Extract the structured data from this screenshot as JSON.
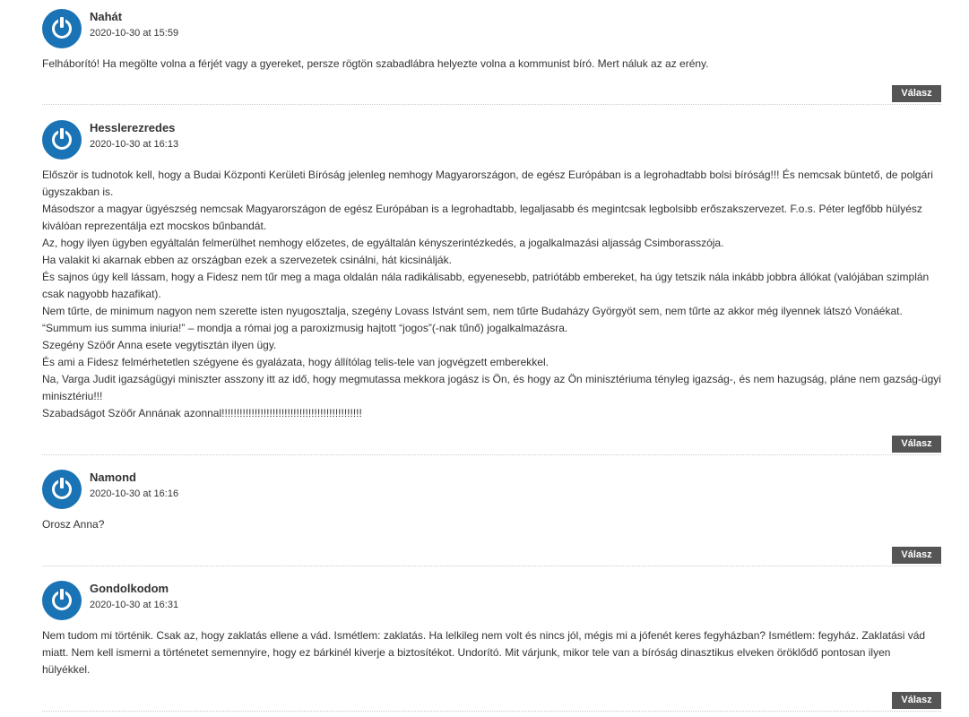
{
  "reply_label": "Válasz",
  "colors": {
    "avatar": "#1a73b5",
    "reply_button": "#555555",
    "text": "#333333"
  },
  "comments": [
    {
      "author": "Nahát",
      "date": "2020-10-30 at 15:59",
      "paragraphs": [
        "Felháborító! Ha megölte volna a férjét vagy a gyereket, persze rögtön szabadlábra helyezte volna a kommunist bíró. Mert náluk az az erény."
      ]
    },
    {
      "author": "Hesslerezredes",
      "date": "2020-10-30 at 16:13",
      "paragraphs": [
        "Először is tudnotok kell, hogy a Budai Központi Kerületi Bíróság jelenleg nemhogy Magyarországon, de egész Európában is a legrohadtabb bolsi bíróság!!! És nemcsak büntető, de polgári ügyszakban is.",
        "Másodszor a magyar ügyészség nemcsak Magyarországon de egész Európában is a legrohadtabb, legaljasabb és megintcsak legbolsibb erőszakszervezet. F.o.s. Péter legfőbb hülyész kiválóan reprezentálja ezt mocskos bűnbandát.",
        "Az, hogy ilyen ügyben egyáltalán felmerülhet nemhogy előzetes, de egyáltalán kényszerintézkedés, a jogalkalmazási aljasság Csimborasszója.",
        "Ha valakit ki akarnak ebben az országban ezek a szervezetek csinálni, hát kicsinálják.",
        "És sajnos úgy kell lássam, hogy a Fidesz nem tűr meg a maga oldalán nála radikálisabb, egyenesebb, patriótább embereket, ha úgy tetszik nála inkább jobbra állókat (valójában szimplán csak nagyobb hazafikat).",
        "Nem tűrte, de minimum nagyon nem szerette isten nyugosztalja, szegény Lovass Istvánt sem, nem tűrte Budaházy Györgyöt sem, nem tűrte az akkor még ilyennek látszó Vonáékat.",
        "“Summum ius summa iniuria!” – mondja a római jog a paroxizmusig hajtott “jogos”(-nak tűnő) jogalkalmazásra.",
        "Szegény Szöőr Anna esete vegytisztán ilyen ügy.",
        "És ami a Fidesz felmérhetetlen szégyene és gyalázata, hogy állítólag telis-tele van jogvégzett emberekkel.",
        "Na, Varga Judit igazságügyi miniszter asszony itt az idő, hogy megmutassa mekkora jogász is Ön, és hogy az Ön minisztériuma tényleg igazság-, és nem hazugság, pláne nem gazság-ügyi minisztériu!!!",
        "Szabadságot Szöőr Annának azonnal!!!!!!!!!!!!!!!!!!!!!!!!!!!!!!!!!!!!!!!!!!!!!!!"
      ]
    },
    {
      "author": "Namond",
      "date": "2020-10-30 at 16:16",
      "paragraphs": [
        "Orosz Anna?"
      ]
    },
    {
      "author": "Gondolkodom",
      "date": "2020-10-30 at 16:31",
      "paragraphs": [
        "Nem tudom mi történik. Csak az, hogy zaklatás ellene a vád. Ismétlem: zaklatás. Ha lelkileg nem volt és nincs jól, mégis mi a jófenét keres fegyházban? Ismétlem: fegyház. Zaklatási vád miatt. Nem kell ismerni a történetet semennyire, hogy ez bárkinél kiverje a biztosítékot. Undorító. Mit várjunk, mikor tele van a bíróság dinasztikus elveken öröklődő pontosan ilyen hülyékkel."
      ]
    }
  ]
}
